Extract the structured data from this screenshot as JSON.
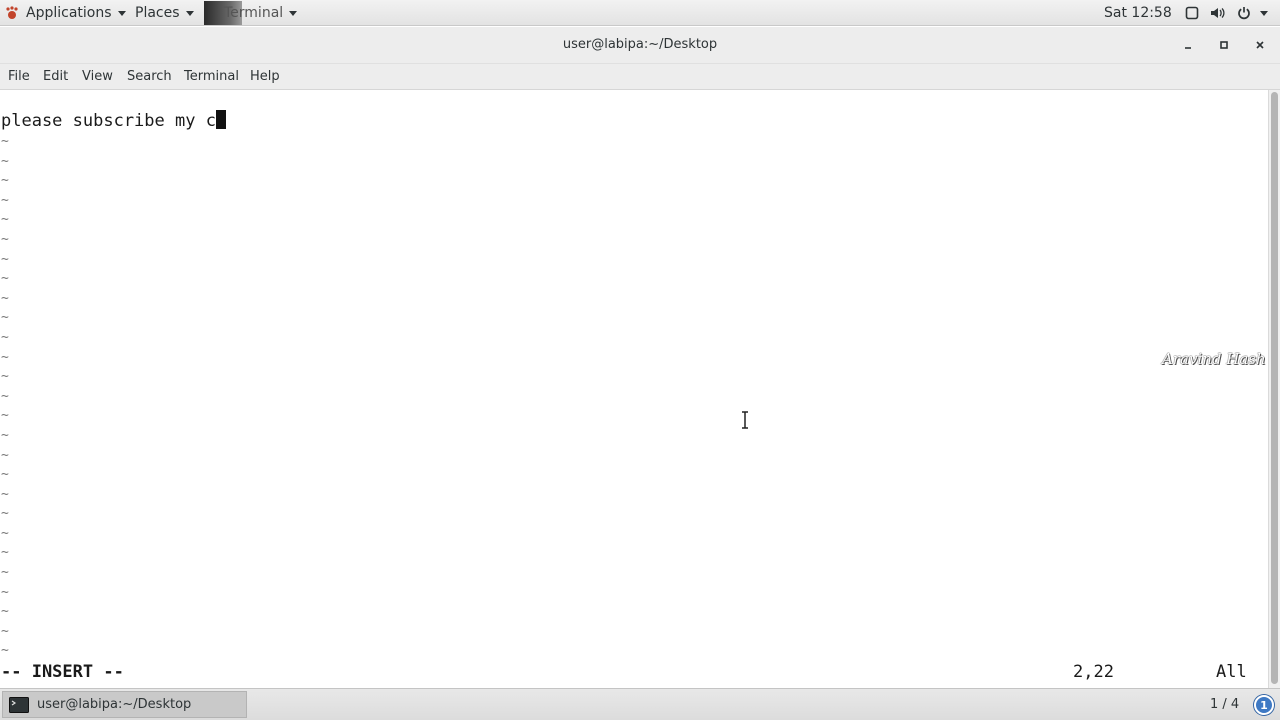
{
  "top_panel": {
    "applications_label": "Applications",
    "places_label": "Places",
    "terminal_label": "Terminal",
    "clock": "Sat 12:58"
  },
  "window": {
    "title": "user@labipa:~/Desktop"
  },
  "menu": {
    "items": [
      "File",
      "Edit",
      "View",
      "Search",
      "Terminal",
      "Help"
    ]
  },
  "editor": {
    "text": "please subscribe my c",
    "tilde": "~",
    "mode": "-- INSERT --",
    "position": "2,22",
    "scroll": "All"
  },
  "watermark": "Aravind Hash",
  "bottom_panel": {
    "task_label": "user@labipa:~/Desktop",
    "workspace": "1 / 4",
    "notification_count": "1"
  },
  "colors": {
    "panel_bg": "#e3e3e3",
    "notify_blue": "#3e79c4"
  }
}
